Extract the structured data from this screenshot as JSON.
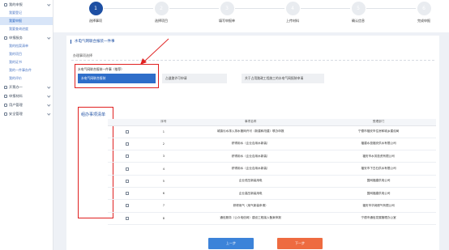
{
  "sidebar": {
    "groups": [
      {
        "label": "我的申报",
        "items": [
          {
            "label": "我要登记"
          },
          {
            "label": "我要申报",
            "active": true
          },
          {
            "label": "我要查询进度"
          }
        ]
      },
      {
        "label": "申报服务",
        "items": [
          {
            "label": "我的档案清单"
          },
          {
            "label": "我的项目"
          },
          {
            "label": "我的证书"
          },
          {
            "label": "我的一件事办件"
          },
          {
            "label": "我的评价"
          }
        ]
      },
      {
        "label": "开票办一",
        "items": []
      },
      {
        "label": "申报材料",
        "items": []
      },
      {
        "label": "用户管理",
        "items": []
      },
      {
        "label": "安全管理",
        "items": []
      }
    ]
  },
  "stepper": {
    "steps": [
      {
        "num": "1",
        "label": "选择事项",
        "active": true
      },
      {
        "num": "2",
        "label": "选择项目",
        "active": false
      },
      {
        "num": "3",
        "label": "填写申报单",
        "active": false
      },
      {
        "num": "4",
        "label": "上传材料",
        "active": false
      },
      {
        "num": "5",
        "label": "确认信息",
        "active": false
      },
      {
        "num": "6",
        "label": "完成申报",
        "active": false
      }
    ]
  },
  "main": {
    "title": "水电气网联合报装一件事",
    "section_label": "办理事项选择",
    "option_label": "水电气网联合报装一件事（推荐）",
    "options": [
      {
        "label": "水电气网联合报装",
        "selected": true
      },
      {
        "label": "占道路许可申请",
        "selected": false
      },
      {
        "label": "关于占用路政工程施工的水电气网报装申请",
        "selected": false
      }
    ],
    "list_title": "组办事项清单",
    "table": {
      "headers": [
        "",
        "序号",
        "事项名称",
        "受理部门"
      ],
      "rows": [
        [
          "1",
          "城镇污水排入排水管网许可（新建和改建）联办申报",
          "宁德市福安市住房和城乡建设局"
        ],
        [
          "2",
          "获得用水（企业自用水新装）",
          "福建水投福安供水有限公司"
        ],
        [
          "3",
          "获得用水（企业自用水新装）",
          "福安市水务投资有限公司"
        ],
        [
          "4",
          "获得用水（企业自用水新装）",
          "福安市下白石供水有限公司"
        ],
        [
          "5",
          "企业低压新装用电",
          "国网福建供电公司"
        ],
        [
          "6",
          "企业高压新装用电",
          "国网福建供电公司"
        ],
        [
          "7",
          "获得用气（用气新装申请）",
          "福安市华润燃气有限公司"
        ],
        [
          "8",
          "通信服务（公众电信网）建设工程接入备案申报",
          "宁德市通信发展管理办公室"
        ]
      ]
    },
    "prev_label": "上一步",
    "next_label": "下一步"
  },
  "colors": {
    "accent": "#1d4fa3",
    "selected_option": "#2f6ec9",
    "next_button": "#ee6b40",
    "prev_button": "#3c83d9",
    "annotation": "#e02020"
  }
}
